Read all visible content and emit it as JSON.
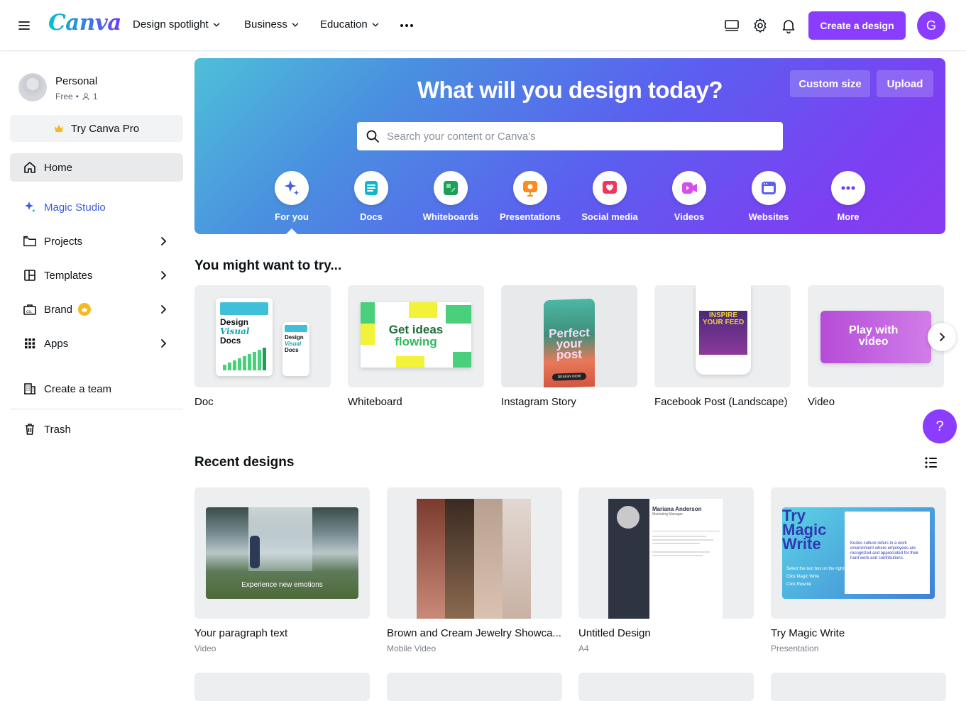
{
  "header": {
    "logo_text": "Canva",
    "nav": [
      {
        "label": "Design spotlight"
      },
      {
        "label": "Business"
      },
      {
        "label": "Education"
      }
    ],
    "create_button": "Create a design",
    "avatar_initial": "G"
  },
  "sidebar": {
    "account_name": "Personal",
    "account_plan": "Free",
    "account_members": "1",
    "try_pro": "Try Canva Pro",
    "items": [
      {
        "label": "Home"
      },
      {
        "label": "Magic Studio"
      },
      {
        "label": "Projects"
      },
      {
        "label": "Templates"
      },
      {
        "label": "Brand"
      },
      {
        "label": "Apps"
      },
      {
        "label": "Create a team"
      },
      {
        "label": "Trash"
      }
    ]
  },
  "hero": {
    "title": "What will you design today?",
    "custom_size": "Custom size",
    "upload": "Upload",
    "search_placeholder": "Search your content or Canva's",
    "categories": [
      {
        "label": "For you"
      },
      {
        "label": "Docs"
      },
      {
        "label": "Whiteboards"
      },
      {
        "label": "Presentations"
      },
      {
        "label": "Social media"
      },
      {
        "label": "Videos"
      },
      {
        "label": "Websites"
      },
      {
        "label": "More"
      }
    ]
  },
  "try_section": {
    "title": "You might want to try...",
    "cards": [
      {
        "label": "Doc",
        "thumb_title_a": "Design",
        "thumb_title_b": "Visual",
        "thumb_title_c": "Docs"
      },
      {
        "label": "Whiteboard",
        "thumb_text_a": "Get ideas",
        "thumb_text_b": "flowing"
      },
      {
        "label": "Instagram Story",
        "thumb_text_a": "Perfect",
        "thumb_text_b": "your",
        "thumb_text_c": "post",
        "thumb_badge": "DESIGN NOW"
      },
      {
        "label": "Facebook Post (Landscape)",
        "thumb_text_a": "INSPIRE",
        "thumb_text_b": "YOUR FEED"
      },
      {
        "label": "Video",
        "thumb_text_a": "Play with",
        "thumb_text_b": "video"
      }
    ]
  },
  "recent": {
    "title": "Recent designs",
    "cards": [
      {
        "title": "Your paragraph text",
        "type": "Video",
        "thumb_caption": "Experience new emotions"
      },
      {
        "title": "Brown and Cream Jewelry Showca...",
        "type": "Mobile Video"
      },
      {
        "title": "Untitled Design",
        "type": "A4",
        "thumb_name": "Mariana Anderson",
        "thumb_role": "Marketing Manager"
      },
      {
        "title": "Try Magic Write",
        "type": "Presentation",
        "thumb_text_a": "Try",
        "thumb_text_b": "Magic",
        "thumb_text_c": "Write",
        "thumb_body": "Kudos culture refers to a work environment where employees are recognized and appreciated for their hard work and contributions.",
        "thumb_step_1": "Select the text box on the right",
        "thumb_step_2": "Click Magic Write",
        "thumb_step_3": "Click Rewrite"
      }
    ]
  },
  "help_label": "?",
  "colors": {
    "accent": "#8b3dff",
    "magic": "#3b5bdb"
  }
}
